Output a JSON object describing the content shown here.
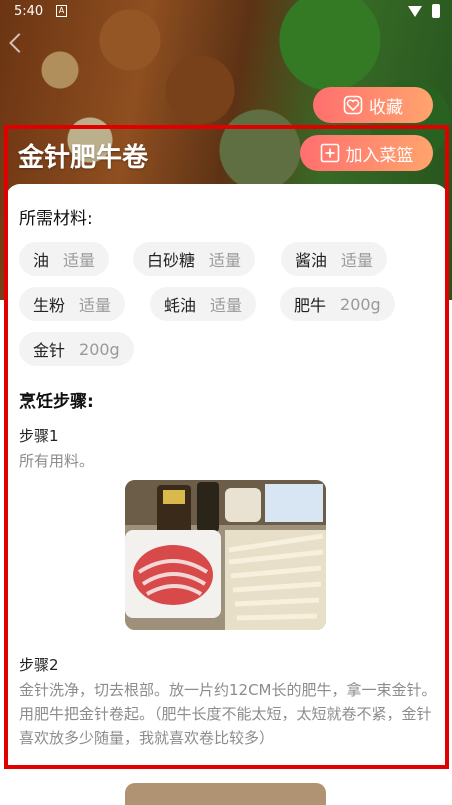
{
  "status_bar": {
    "time": "5:40",
    "indicator": "A"
  },
  "recipe": {
    "title": "金针肥牛卷"
  },
  "actions": {
    "favorite_label": "收藏",
    "add_basket_label": "加入菜篮"
  },
  "ingredients": {
    "title": "所需材料:",
    "items": [
      {
        "name": "油",
        "amount": "适量"
      },
      {
        "name": "白砂糖",
        "amount": "适量"
      },
      {
        "name": "酱油",
        "amount": "适量"
      },
      {
        "name": "生粉",
        "amount": "适量"
      },
      {
        "name": "蚝油",
        "amount": "适量"
      },
      {
        "name": "肥牛",
        "amount": "200g"
      },
      {
        "name": "金针",
        "amount": "200g"
      }
    ]
  },
  "steps": {
    "title": "烹饪步骤:",
    "items": [
      {
        "label": "步骤1",
        "desc": "所有用料。"
      },
      {
        "label": "步骤2",
        "desc": "金针洗净，切去根部。放一片约12CM长的肥牛，拿一束金针。用肥牛把金针卷起。（肥牛长度不能太短，太短就卷不紧，金针喜欢放多少随量，我就喜欢卷比较多）"
      }
    ]
  },
  "colors": {
    "accent_start": "#ff6f6f",
    "accent_end": "#ffa46d",
    "highlight": "#e00000"
  }
}
